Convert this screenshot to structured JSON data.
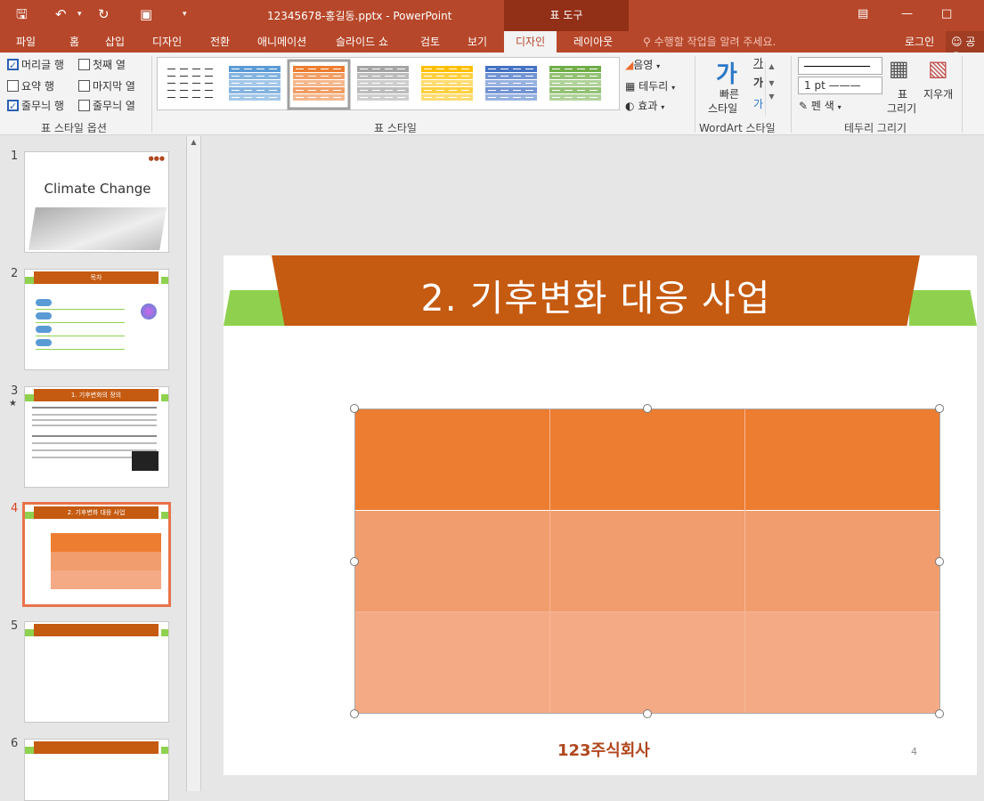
{
  "window": {
    "title": "12345678-홍길동.pptx - PowerPoint",
    "tool_tab": "표 도구"
  },
  "tabs": [
    "파일",
    "홈",
    "삽입",
    "디자인",
    "전환",
    "애니메이션",
    "슬라이드 쇼",
    "검토",
    "보기",
    "디자인",
    "레이아웃"
  ],
  "tell_me": "수행할 작업을 알려 주세요.",
  "login": "로그인",
  "share": "공유",
  "style_options": {
    "header_row": "머리글 행",
    "first_col": "첫째 열",
    "total_row": "요약 행",
    "last_col": "마지막 열",
    "banded_rows": "줄무늬 행",
    "banded_cols": "줄무늬 열",
    "label": "표 스타일 옵션"
  },
  "table_styles": {
    "label": "표 스타일",
    "shading": "음영",
    "borders": "테두리",
    "effects": "효과"
  },
  "wordart": {
    "quick_styles_1": "빠른",
    "quick_styles_2": "스타일",
    "label": "WordArt 스타일"
  },
  "draw_borders": {
    "pen_weight": "1 pt",
    "pen_color": "펜 색",
    "draw_table_1": "표",
    "draw_table_2": "그리기",
    "eraser": "지우개",
    "label": "테두리 그리기"
  },
  "swatch_colors": [
    "#ffffff",
    "#5b9bd5",
    "#ed7d31",
    "#a5a5a5",
    "#ffc000",
    "#4472c4",
    "#70ad47"
  ],
  "thumbnails": [
    {
      "num": "1",
      "title": "Climate Change"
    },
    {
      "num": "2",
      "title": "목차"
    },
    {
      "num": "3",
      "title": "1. 기후변화의 정의"
    },
    {
      "num": "4",
      "title": "2. 기후변화 대응 사업"
    },
    {
      "num": "5",
      "title": ""
    },
    {
      "num": "6",
      "title": ""
    }
  ],
  "slide": {
    "title": "2. 기후변화 대응 사업",
    "page": "4",
    "logo": "123주식회사"
  },
  "colors": {
    "accent": "#b7472a",
    "banner": "#c55a11",
    "green": "#8fd14f",
    "row1": "#ed7d31",
    "row2": "#f19d6d",
    "row3": "#f5aa86"
  }
}
